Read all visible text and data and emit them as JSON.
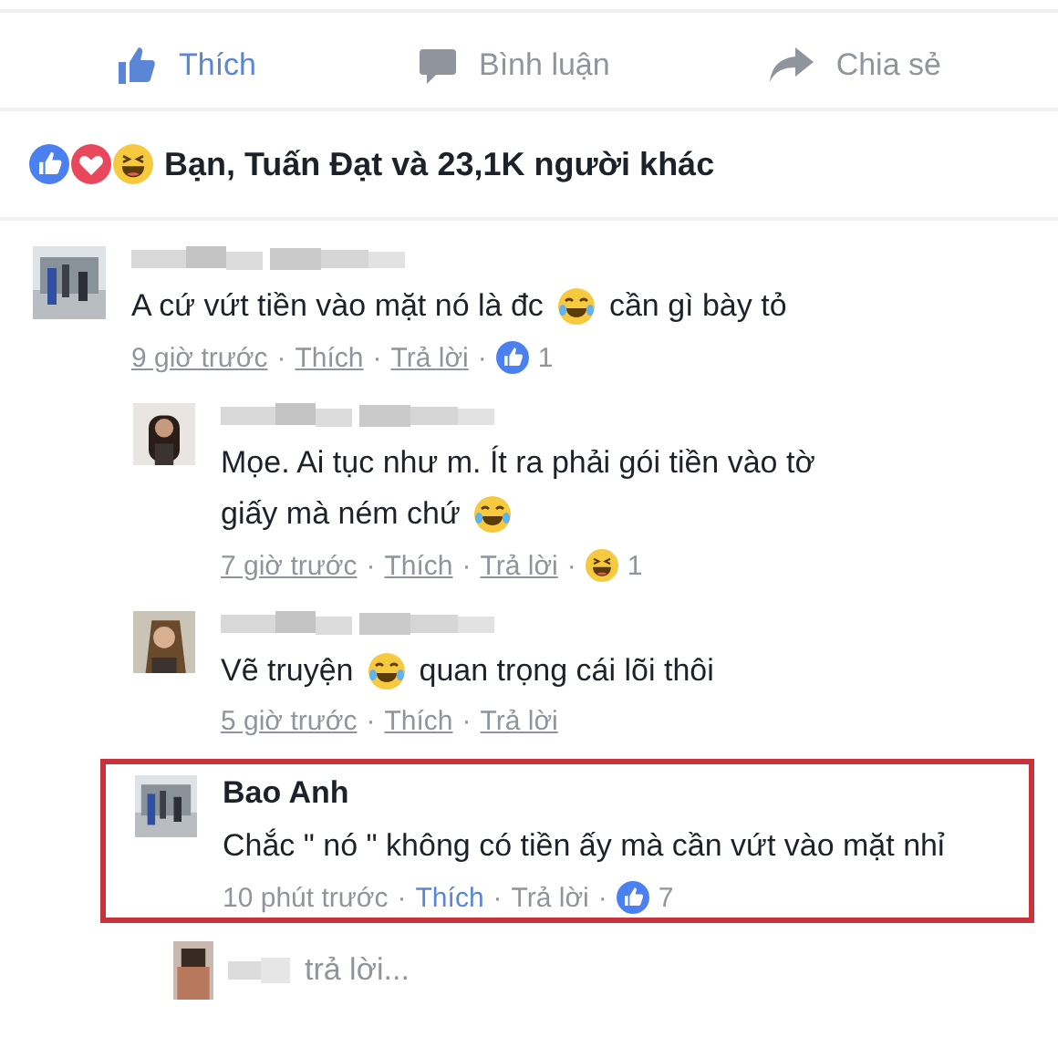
{
  "actions": [
    {
      "kind": "like",
      "label": "Thích",
      "selected": true
    },
    {
      "kind": "comment",
      "label": "Bình luận",
      "selected": false
    },
    {
      "kind": "share",
      "label": "Chia sẻ",
      "selected": false
    }
  ],
  "reactions_summary": {
    "icons": [
      {
        "kind": "like"
      },
      {
        "kind": "love"
      },
      {
        "kind": "haha"
      }
    ],
    "text": "Bạn, Tuấn Đạt và 23,1K người khác"
  },
  "separator": "·",
  "comments": [
    {
      "body": [
        {
          "kind": "text",
          "text": "A cứ vứt tiền vào mặt nó là đc"
        },
        {
          "kind": "emoji"
        },
        {
          "kind": "text",
          "text": "cần gì bày tỏ"
        }
      ],
      "time": "9 giờ trước",
      "like_label": "Thích",
      "reply_label": "Trả lời",
      "liked": false,
      "highlighted": false,
      "reaction": {
        "kind": "like",
        "count": "1"
      },
      "children": [
        {
          "body": [
            {
              "kind": "text",
              "text": "Mọe. Ai tục như m. Ít ra phải gói tiền vào tờ"
            },
            {
              "kind": "text",
              "text": "giấy mà ném chứ"
            },
            {
              "kind": "emoji"
            }
          ],
          "time": "7 giờ trước",
          "like_label": "Thích",
          "reply_label": "Trả lời",
          "liked": false,
          "highlighted": false,
          "reaction": {
            "kind": "haha",
            "count": "1"
          }
        },
        {
          "body": [
            {
              "kind": "text",
              "text": "Vẽ truyện"
            },
            {
              "kind": "emoji"
            },
            {
              "kind": "text",
              "text": "quan trọng cái lõi thôi"
            }
          ],
          "time": "5 giờ trước",
          "like_label": "Thích",
          "reply_label": "Trả lời",
          "liked": false,
          "highlighted": false
        },
        {
          "name": "Bao Anh",
          "body": [
            {
              "kind": "text",
              "text": "Chắc \" nó \" không có tiền ấy mà cần vứt vào mặt nhỉ"
            }
          ],
          "time": "10 phút trước",
          "like_label": "Thích",
          "reply_label": "Trả lời",
          "liked": true,
          "highlighted": true,
          "reaction": {
            "kind": "like",
            "count": "7"
          }
        }
      ],
      "typing": {
        "text": "trả lời..."
      }
    }
  ]
}
